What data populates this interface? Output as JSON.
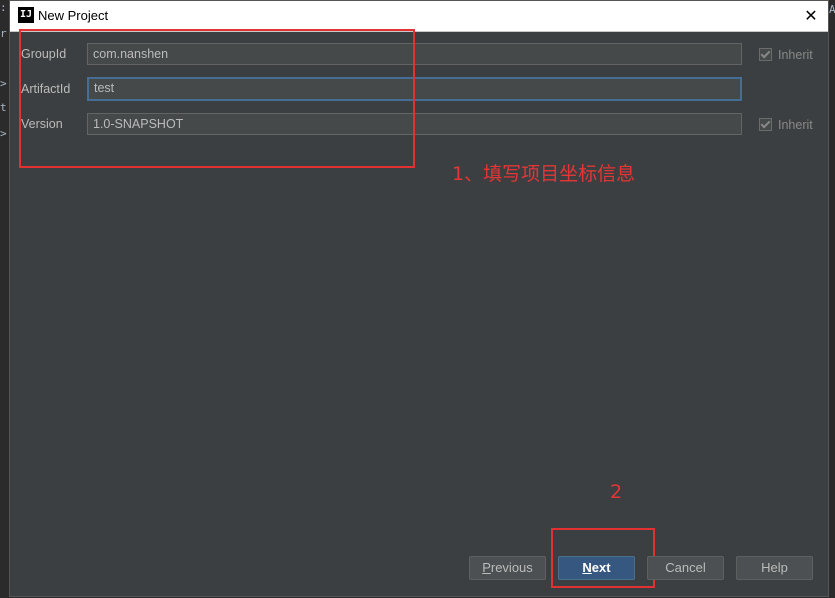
{
  "window": {
    "title": "New Project",
    "close_glyph": "✕",
    "icon_letter": "IJ"
  },
  "background_glyphs": [
    ":",
    "r",
    ">",
    "t",
    ">",
    "A"
  ],
  "form": {
    "rows": [
      {
        "label": "GroupId",
        "value": "com.nanshen",
        "inherit": "Inherit",
        "inherit_checked": true
      },
      {
        "label": "ArtifactId",
        "value": "test",
        "focused": true
      },
      {
        "label": "Version",
        "value": "1.0-SNAPSHOT",
        "inherit": "Inherit",
        "inherit_checked": true
      }
    ]
  },
  "annotations": {
    "step1": "1、填写项目坐标信息",
    "step2": "2"
  },
  "buttons": {
    "previous": {
      "mnemonic": "P",
      "rest": "revious"
    },
    "next": {
      "mnemonic": "N",
      "rest": "ext"
    },
    "cancel": "Cancel",
    "help": "Help"
  },
  "colors": {
    "dialog_bg": "#3c3f41",
    "annotation_red": "#e53535",
    "primary_button": "#365880",
    "focus_border": "#466d94"
  }
}
